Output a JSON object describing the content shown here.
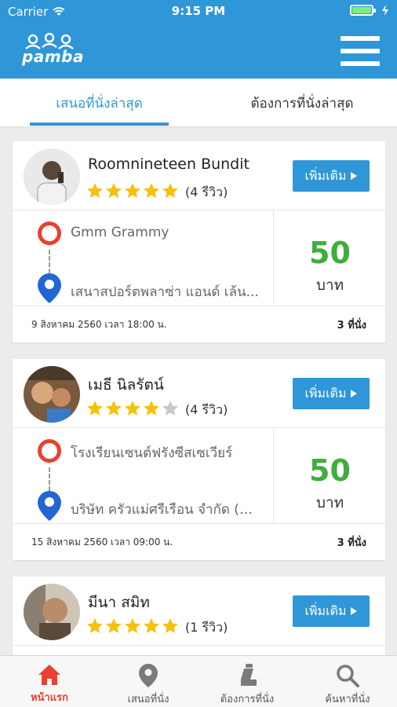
{
  "status_bar": {
    "carrier": "Carrier",
    "time": "9:15 PM"
  },
  "header": {
    "logo_text": "pamba"
  },
  "tabs": [
    {
      "label": "เสนอที่นั่งล่าสุด",
      "active": true
    },
    {
      "label": "ต้องการที่นั่งล่าสุด",
      "active": false
    }
  ],
  "more_button_label": "เพิ่มเติม",
  "cards": [
    {
      "name": "Roomnineteen Bundit",
      "rating": 5,
      "reviews": "(4 รีวิว)",
      "origin": "Gmm Grammy",
      "destination": "เสนาสปอร์ตพลาซ่า แอนด์ เล้น...",
      "price": "50",
      "currency": "บาท",
      "datetime": "9 สิงหาคม 2560 เวลา 18:00 น.",
      "seats": "3 ที่นั่ง"
    },
    {
      "name": "เมธี นิลรัตน์",
      "rating": 4,
      "reviews": "(4 รีวิว)",
      "origin": "โรงเรียนเซนต์ฟรังซีสเซเวียร์",
      "destination": "บริษัท ครัวแม่ศรีเรือน จำกัด (สำ...",
      "price": "50",
      "currency": "บาท",
      "datetime": "15 สิงหาคม 2560 เวลา 09:00 น.",
      "seats": "3 ที่นั่ง"
    },
    {
      "name": "มีนา สมิท",
      "rating": 5,
      "reviews": "(1 รีวิว)"
    }
  ],
  "bottom_nav": [
    {
      "label": "หน้าแรก",
      "icon": "home-icon",
      "active": true
    },
    {
      "label": "เสนอที่นั่ง",
      "icon": "location-pin-icon",
      "active": false
    },
    {
      "label": "ต้องการที่นั่ง",
      "icon": "car-seat-icon",
      "active": false
    },
    {
      "label": "ค้นหาที่นั่ง",
      "icon": "search-icon",
      "active": false
    }
  ],
  "colors": {
    "primary": "#2f96d7",
    "price": "#3fae3a",
    "accent": "#e9402f",
    "star": "#f4c20d"
  }
}
